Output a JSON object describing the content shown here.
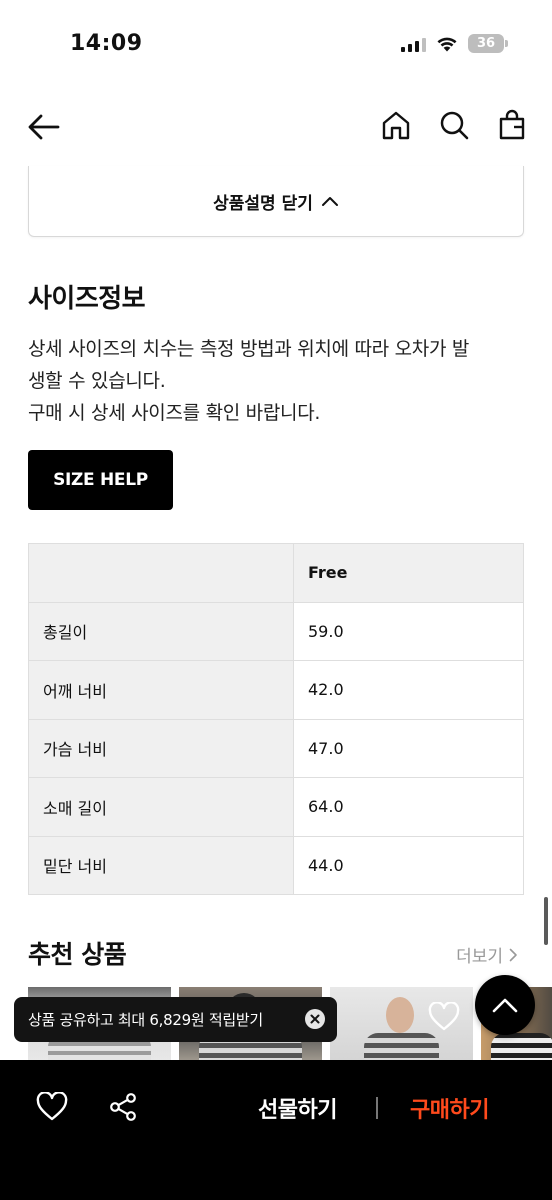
{
  "status_bar": {
    "time": "14:09",
    "battery": "36"
  },
  "collapse": {
    "label": "상품설명 닫기"
  },
  "size_info": {
    "title": "사이즈정보",
    "description_lines": [
      "상세 사이즈의 치수는 측정 방법과 위치에 따라 오차가 발",
      "생할 수 있습니다.",
      "구매 시 상세 사이즈를 확인 바랍니다."
    ],
    "help_button": "SIZE HELP",
    "table": {
      "header": [
        "",
        "Free"
      ],
      "rows": [
        {
          "label": "총길이",
          "value": "59.0"
        },
        {
          "label": "어깨 너비",
          "value": "42.0"
        },
        {
          "label": "가슴 너비",
          "value": "47.0"
        },
        {
          "label": "소매 길이",
          "value": "64.0"
        },
        {
          "label": "밑단 너비",
          "value": "44.0"
        }
      ]
    }
  },
  "recommend": {
    "title": "추천 상품",
    "more": "더보기"
  },
  "toast": {
    "text": "상품 공유하고 최대 6,829원 적립받기"
  },
  "bottom_bar": {
    "gift": "선물하기",
    "buy": "구매하기"
  },
  "colors": {
    "accent": "#ff4a1c",
    "bottom_bar_bg": "#000000"
  },
  "icons": [
    "back-arrow-icon",
    "home-icon",
    "search-icon",
    "shopping-bag-icon",
    "chevron-up-icon",
    "chevron-right-icon",
    "heart-icon",
    "share-icon",
    "close-icon",
    "arrow-up-icon"
  ]
}
